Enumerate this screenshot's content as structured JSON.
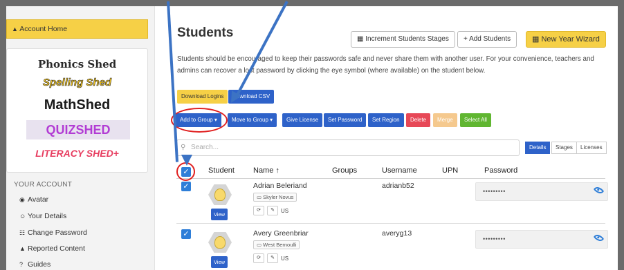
{
  "sidebar": {
    "account_home": "Account Home",
    "logos": [
      "Phonics Shed",
      "Spelling Shed",
      "MathShed",
      "QUIZSHED",
      "LITERACY SHED+"
    ],
    "section_title": "YOUR ACCOUNT",
    "links": [
      {
        "icon": "person-circle-icon",
        "label": "Avatar"
      },
      {
        "icon": "person-icon",
        "label": "Your Details"
      },
      {
        "icon": "key-person-icon",
        "label": "Change Password"
      },
      {
        "icon": "warning-icon",
        "label": "Reported Content"
      },
      {
        "icon": "question-icon",
        "label": "Guides"
      }
    ]
  },
  "header": {
    "title": "Students",
    "increment_label": "Increment Students Stages",
    "add_students_label": "+ Add Students",
    "new_year_label": "New Year Wizard"
  },
  "description": "Students should be encouraged to keep their passwords safe and never share them with another user. For your convenience, teachers and admins can recover a lost password by clicking the eye symbol (where available) on the student below.",
  "downloads": {
    "logins": "Download Logins",
    "csv": "Download CSV"
  },
  "actions": {
    "add_to_group": "Add to Group",
    "move_to_group": "Move to Group",
    "give_license": "Give License",
    "set_password": "Set Password",
    "set_region": "Set Region",
    "delete": "Delete",
    "merge": "Merge",
    "select_all": "Select All"
  },
  "search": {
    "placeholder": "Search..."
  },
  "view_tabs": [
    "Details",
    "Stages",
    "Licenses"
  ],
  "table": {
    "headers": [
      "Student",
      "Name ↑",
      "Groups",
      "Username",
      "UPN",
      "Password"
    ],
    "view_label": "View",
    "rows": [
      {
        "name": "Adrian Beleriand",
        "class": "Skyler Novus",
        "region": "US",
        "username": "adrianb52",
        "password": "•••••••••"
      },
      {
        "name": "Avery Greenbriar",
        "class": "West Bernoulli",
        "region": "US",
        "username": "averyg13",
        "password": "•••••••••"
      }
    ]
  },
  "colors": {
    "accent_yellow": "#f6d046",
    "primary_blue": "#2e62c9",
    "annotation_red": "#e02020",
    "annotation_arrow": "#3c73c4"
  }
}
